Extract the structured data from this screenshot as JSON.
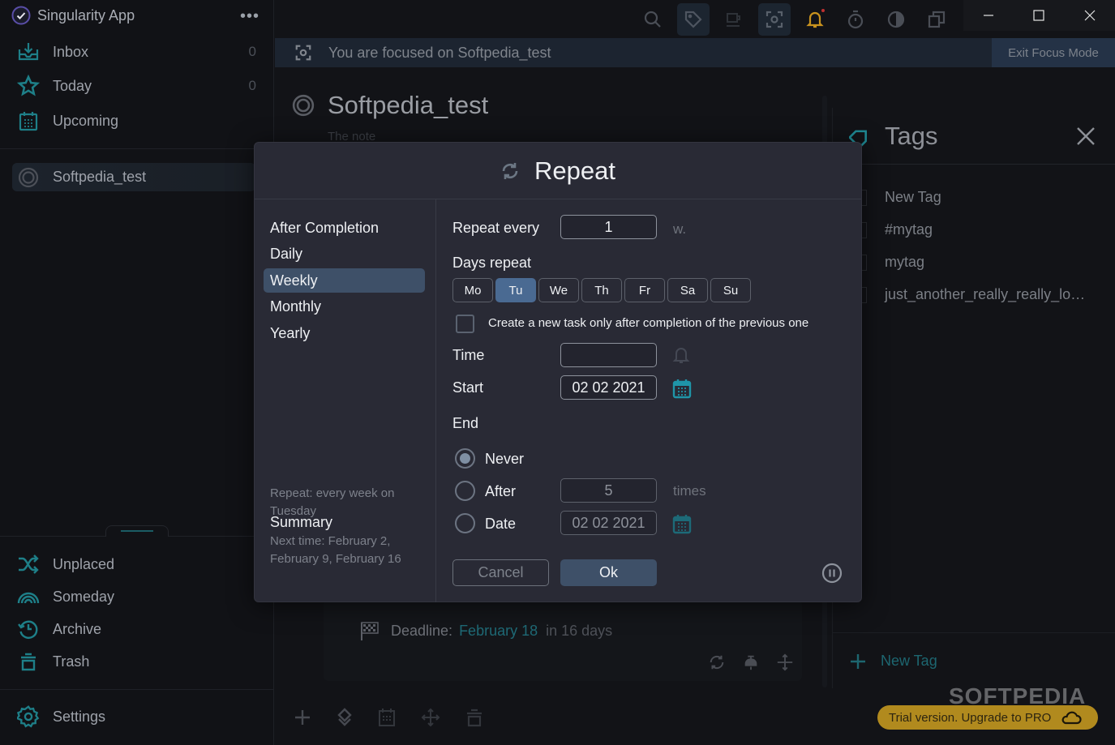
{
  "app": {
    "title": "Singularity App",
    "more_label": "•••"
  },
  "sidebar": {
    "top_items": [
      {
        "label": "Inbox",
        "count": "0",
        "icon": "inbox-icon"
      },
      {
        "label": "Today",
        "count": "0",
        "icon": "star-icon"
      },
      {
        "label": "Upcoming",
        "count": "",
        "icon": "calendar-icon"
      }
    ],
    "project": {
      "label": "Softpedia_test"
    },
    "bottom_items": [
      {
        "label": "Unplaced",
        "icon": "shuffle-icon"
      },
      {
        "label": "Someday",
        "icon": "rainbow-icon"
      },
      {
        "label": "Archive",
        "icon": "history-icon"
      },
      {
        "label": "Trash",
        "icon": "trash-icon"
      }
    ],
    "settings": {
      "label": "Settings"
    }
  },
  "focus": {
    "text": "You are focused on Softpedia_test",
    "exit_label": "Exit Focus Mode"
  },
  "task": {
    "title": "Softpedia_test",
    "note_placeholder": "The note",
    "deadline_label": "Deadline:",
    "deadline_date": "February 18",
    "deadline_relative": "in 16 days"
  },
  "tags_panel": {
    "title": "Tags",
    "tags": [
      "New Tag",
      "#mytag",
      "mytag",
      "just_another_really_really_lo…"
    ],
    "new_tag_label": "New Tag"
  },
  "trial": {
    "label": "Trial version. Upgrade to PRO"
  },
  "watermark": "SOFTPEDIA",
  "repeat_dialog": {
    "title": "Repeat",
    "frequencies": [
      {
        "label": "After Completion",
        "selected": false
      },
      {
        "label": "Daily",
        "selected": false
      },
      {
        "label": "Weekly",
        "selected": true
      },
      {
        "label": "Monthly",
        "selected": false
      },
      {
        "label": "Yearly",
        "selected": false
      }
    ],
    "summary_title": "Summary",
    "summary_repeat": "Repeat: every week on Tuesday",
    "summary_next": "Next time: February 2, February 9, February 16",
    "repeat_every_label": "Repeat every",
    "repeat_every_value": "1",
    "repeat_every_unit": "w.",
    "days_label": "Days repeat",
    "days": [
      {
        "label": "Mo",
        "selected": false
      },
      {
        "label": "Tu",
        "selected": true
      },
      {
        "label": "We",
        "selected": false
      },
      {
        "label": "Th",
        "selected": false
      },
      {
        "label": "Fr",
        "selected": false
      },
      {
        "label": "Sa",
        "selected": false
      },
      {
        "label": "Su",
        "selected": false
      }
    ],
    "create_after_label": "Create a new task only after completion of the previous one",
    "create_after_checked": false,
    "time_label": "Time",
    "time_value": "",
    "start_label": "Start",
    "start_value": "02 02 2021",
    "end_label": "End",
    "end_options": [
      {
        "label": "Never",
        "selected": true
      },
      {
        "label": "After",
        "selected": false,
        "value": "5",
        "unit": "times"
      },
      {
        "label": "Date",
        "selected": false,
        "value": "02 02 2021"
      }
    ],
    "cancel_label": "Cancel",
    "ok_label": "Ok"
  }
}
